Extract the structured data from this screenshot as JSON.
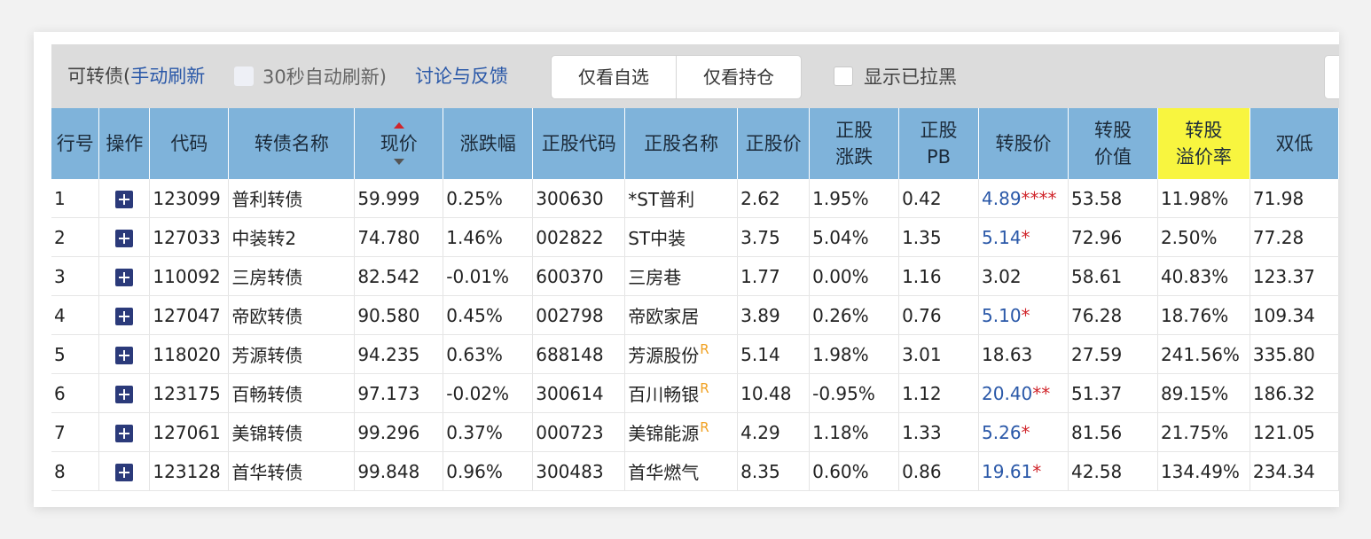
{
  "toolbar": {
    "title_prefix": "可转债(",
    "manual_refresh": "手动刷新",
    "auto_refresh_label": "30秒自动刷新)",
    "discuss_link": "讨论与反馈",
    "filter_watchlist": "仅看自选",
    "filter_holdings": "仅看持仓",
    "show_blacklisted_label": "显示已拉黑"
  },
  "table": {
    "headers": {
      "row_no": "行号",
      "action": "操作",
      "code": "代码",
      "name": "转债名称",
      "price": "现价",
      "change": "涨跌幅",
      "stock_code": "正股代码",
      "stock_name": "正股名称",
      "stock_price": "正股价",
      "stock_change_1": "正股",
      "stock_change_2": "涨跌",
      "stock_pb_1": "正股",
      "stock_pb_2": "PB",
      "conv_price": "转股价",
      "conv_value_1": "转股",
      "conv_value_2": "价值",
      "premium_1": "转股",
      "premium_2": "溢价率",
      "double_low": "双低"
    },
    "rows": [
      {
        "no": "1",
        "code": "123099",
        "name": "普利转债",
        "price": "59.999",
        "change": "0.25%",
        "stock_code": "300630",
        "stock_name": "*ST普利",
        "r": "",
        "stock_price": "2.62",
        "stock_change": "1.95%",
        "pb": "0.42",
        "conv_price": "4.89",
        "stars": "****",
        "conv_value": "53.58",
        "premium": "11.98%",
        "double_low": "71.98"
      },
      {
        "no": "2",
        "code": "127033",
        "name": "中装转2",
        "price": "74.780",
        "change": "1.46%",
        "stock_code": "002822",
        "stock_name": "ST中装",
        "r": "",
        "stock_price": "3.75",
        "stock_change": "5.04%",
        "pb": "1.35",
        "conv_price": "5.14",
        "stars": "*",
        "conv_value": "72.96",
        "premium": "2.50%",
        "double_low": "77.28"
      },
      {
        "no": "3",
        "code": "110092",
        "name": "三房转债",
        "price": "82.542",
        "change": "-0.01%",
        "stock_code": "600370",
        "stock_name": "三房巷",
        "r": "",
        "stock_price": "1.77",
        "stock_change": "0.00%",
        "pb": "1.16",
        "conv_price": "3.02",
        "stars": "",
        "conv_value": "58.61",
        "premium": "40.83%",
        "double_low": "123.37"
      },
      {
        "no": "4",
        "code": "127047",
        "name": "帝欧转债",
        "price": "90.580",
        "change": "0.45%",
        "stock_code": "002798",
        "stock_name": "帝欧家居",
        "r": "",
        "stock_price": "3.89",
        "stock_change": "0.26%",
        "pb": "0.76",
        "conv_price": "5.10",
        "stars": "*",
        "conv_value": "76.28",
        "premium": "18.76%",
        "double_low": "109.34"
      },
      {
        "no": "5",
        "code": "118020",
        "name": "芳源转债",
        "price": "94.235",
        "change": "0.63%",
        "stock_code": "688148",
        "stock_name": "芳源股份",
        "r": "R",
        "stock_price": "5.14",
        "stock_change": "1.98%",
        "pb": "3.01",
        "conv_price": "18.63",
        "stars": "",
        "conv_value": "27.59",
        "premium": "241.56%",
        "double_low": "335.80"
      },
      {
        "no": "6",
        "code": "123175",
        "name": "百畅转债",
        "price": "97.173",
        "change": "-0.02%",
        "stock_code": "300614",
        "stock_name": "百川畅银",
        "r": "R",
        "stock_price": "10.48",
        "stock_change": "-0.95%",
        "pb": "1.12",
        "conv_price": "20.40",
        "stars": "**",
        "conv_value": "51.37",
        "premium": "89.15%",
        "double_low": "186.32"
      },
      {
        "no": "7",
        "code": "127061",
        "name": "美锦转债",
        "price": "99.296",
        "change": "0.37%",
        "stock_code": "000723",
        "stock_name": "美锦能源",
        "r": "R",
        "stock_price": "4.29",
        "stock_change": "1.18%",
        "pb": "1.33",
        "conv_price": "5.26",
        "stars": "*",
        "conv_value": "81.56",
        "premium": "21.75%",
        "double_low": "121.05"
      },
      {
        "no": "8",
        "code": "123128",
        "name": "首华转债",
        "price": "99.848",
        "change": "0.96%",
        "stock_code": "300483",
        "stock_name": "首华燃气",
        "r": "",
        "stock_price": "8.35",
        "stock_change": "0.60%",
        "pb": "0.86",
        "conv_price": "19.61",
        "stars": "*",
        "conv_value": "42.58",
        "premium": "134.49%",
        "double_low": "234.34"
      }
    ]
  },
  "colors": {
    "link": "#2a58a8",
    "up": "#d0252b",
    "down": "#1e8a2a",
    "header_bg": "#7fb3da",
    "highlight_header": "#f8f53f",
    "r_mark": "#f0a020"
  },
  "icons": {
    "add": "plus-square-icon",
    "sort": "sort-arrows-icon"
  }
}
